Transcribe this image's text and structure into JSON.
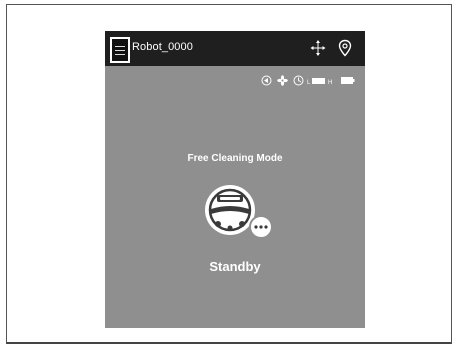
{
  "header": {
    "robot_name": "Robot_0000",
    "menu_icon": "hamburger-menu-icon",
    "icons": [
      "move-arrows-icon",
      "location-pin-icon"
    ]
  },
  "status_bar": {
    "icons": [
      "dock-icon",
      "fan-icon",
      "clock-icon",
      "water-level-icon",
      "battery-icon"
    ]
  },
  "main": {
    "mode_label": "Free Cleaning Mode",
    "status_label": "Standby",
    "robot_icon": "robot-vacuum-icon",
    "more_icon": "more-options-icon"
  },
  "colors": {
    "topbar": "#1f1f1f",
    "background": "#8f8f8f",
    "text": "#ffffff"
  }
}
